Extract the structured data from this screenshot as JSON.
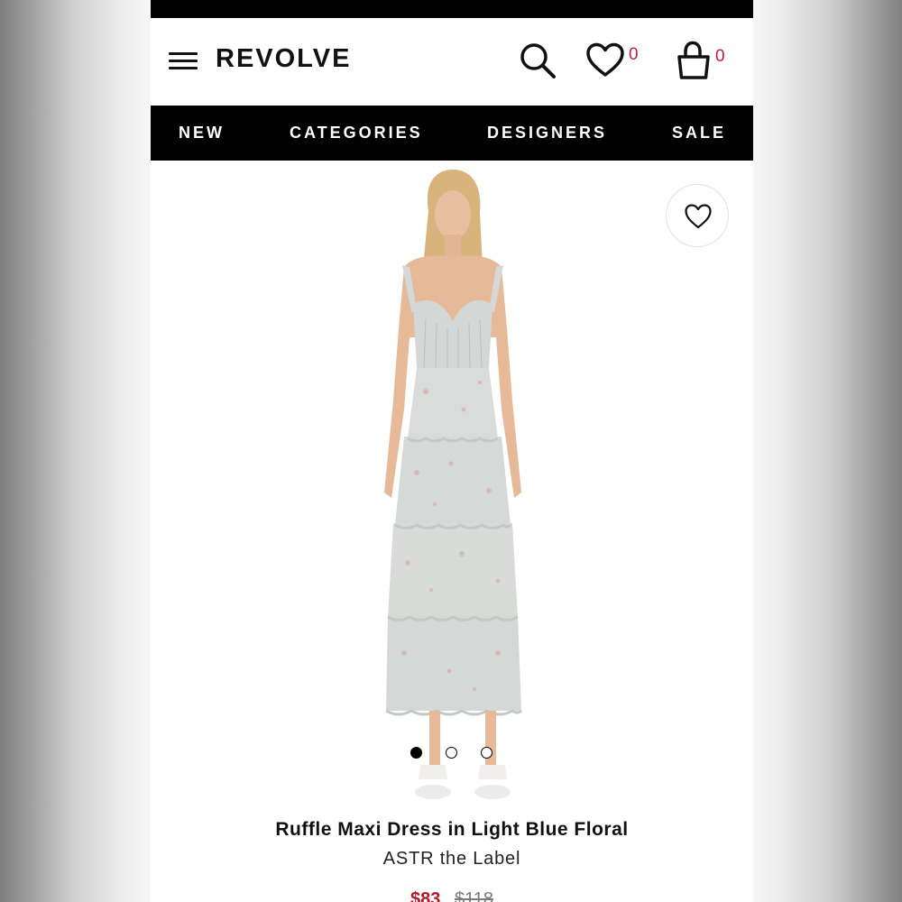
{
  "header": {
    "logo": "REVOLVE",
    "wishlist_count": "0",
    "bag_count": "0"
  },
  "nav": {
    "items": [
      "NEW",
      "CATEGORIES",
      "DESIGNERS",
      "SALE"
    ]
  },
  "carousel": {
    "dots": 3,
    "active_index": 0
  },
  "product": {
    "title": "Ruffle Maxi Dress in Light Blue Floral",
    "brand": "ASTR the Label",
    "sale_price": "$83",
    "original_price": "$118"
  },
  "colors": {
    "accent_count": "#c2185b",
    "sale_price": "#b0182b",
    "nav_bg": "#000000"
  }
}
